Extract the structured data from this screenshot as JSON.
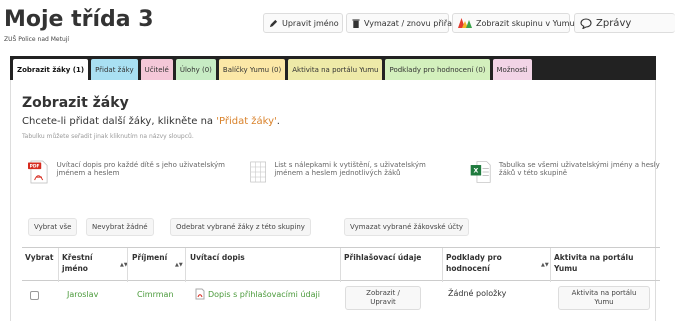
{
  "header": {
    "title": "Moje třída 3",
    "subtitle": "ZUŠ Police nad Metují"
  },
  "toolbar": {
    "rename": "Upravit jméno",
    "delete": "Vymazat / znovu přiřadit",
    "show_group": "Zobrazit skupinu v Yumu",
    "messages": "Zprávy"
  },
  "tabs": [
    {
      "label": "Zobrazit žáky (1)",
      "color": "#ffffff"
    },
    {
      "label": "Přidat žáky",
      "color": "#a9e0f2"
    },
    {
      "label": "Učitelé",
      "color": "#f4c7d8"
    },
    {
      "label": "Úlohy (0)",
      "color": "#c7ecc4"
    },
    {
      "label": "Balíčky Yumu (0)",
      "color": "#fce8a7"
    },
    {
      "label": "Aktivita na portálu Yumu",
      "color": "#eeeaa8"
    },
    {
      "label": "Podklady pro hodnocení (0)",
      "color": "#d3f0bd"
    },
    {
      "label": "Možnosti",
      "color": "#f2d4e6"
    }
  ],
  "section": {
    "heading": "Zobrazit žáky",
    "intro_before": "Chcete-li přidat další žáky, klikněte na ",
    "intro_link": "'Přidat žáky'",
    "intro_after": ".",
    "hint": "Tabulku můžete seřadit jinak kliknutím na názvy sloupců."
  },
  "print_options": [
    {
      "icon": "pdf-icon",
      "text": "Uvítací dopis pro každé dítě s jeho uživatelským jménem a heslem"
    },
    {
      "icon": "label-sheet-icon",
      "text": "List s nálepkami k vytištění, s uživatelským jménem a heslem jednotlivých žáků"
    },
    {
      "icon": "spreadsheet-icon",
      "text": "Tabulka se všemi uživatelskými jmény a hesly žáků v této skupině"
    }
  ],
  "actions": {
    "select_all": "Vybrat vše",
    "select_none": "Nevybrat žádné",
    "remove_selected": "Odebrat vybrané žáky z této skupiny",
    "delete_accounts": "Vymazat vybrané žákovské účty"
  },
  "table": {
    "columns": {
      "select": "Vybrat",
      "first_name": "Křestní jméno",
      "last_name": "Příjmení",
      "letter": "Uvítací dopis",
      "login": "Přihlašovací údaje",
      "grading": "Podklady pro hodnocení",
      "activity": "Aktivita na portálu Yumu"
    },
    "rows": [
      {
        "first_name": "Jaroslav",
        "last_name": "Cimrman",
        "letter": "Dopis s přihlašovacími údaji",
        "login_button": "Zobrazit / Upravit",
        "grading": "Žádné položky",
        "activity_button": "Aktivita na portálu Yumu"
      }
    ]
  }
}
